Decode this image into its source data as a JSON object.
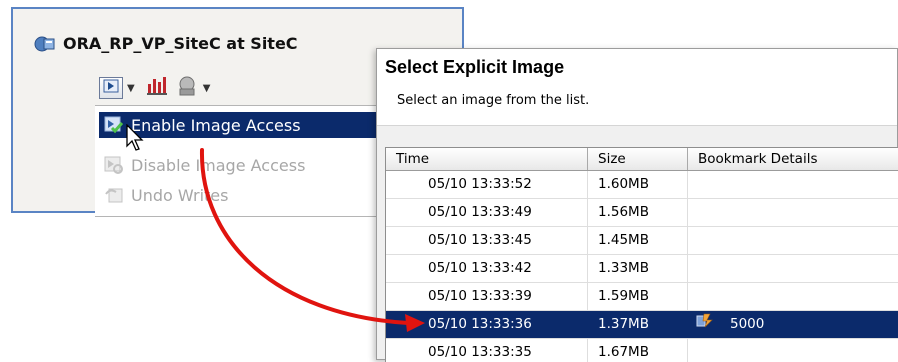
{
  "left_panel": {
    "title": "ORA_RP_VP_SiteC at SiteC",
    "toolbar": {
      "icons": [
        "image-access-icon",
        "dropdown-arrow",
        "bar-chart-icon",
        "support-icon",
        "dropdown-arrow"
      ]
    },
    "menu": {
      "items": [
        {
          "label": "Enable Image Access",
          "state": "selected",
          "icon": "enable-image-access-icon"
        },
        {
          "label": "Disable Image Access",
          "state": "disabled",
          "icon": "disable-image-access-icon"
        },
        {
          "label": "Undo Writes",
          "state": "disabled",
          "icon": "undo-writes-icon"
        }
      ]
    }
  },
  "dialog": {
    "title": "Select Explicit Image",
    "subtitle": "Select an image from the list.",
    "columns": [
      "Time",
      "Size",
      "Bookmark Details"
    ],
    "rows": [
      {
        "time": "05/10 13:33:52",
        "size": "1.60MB",
        "bookmark": ""
      },
      {
        "time": "05/10 13:33:49",
        "size": "1.56MB",
        "bookmark": ""
      },
      {
        "time": "05/10 13:33:45",
        "size": "1.45MB",
        "bookmark": ""
      },
      {
        "time": "05/10 13:33:42",
        "size": "1.33MB",
        "bookmark": ""
      },
      {
        "time": "05/10 13:33:39",
        "size": "1.59MB",
        "bookmark": ""
      },
      {
        "time": "05/10 13:33:36",
        "size": "1.37MB",
        "bookmark": "5000",
        "selected": true
      },
      {
        "time": "05/10 13:33:35",
        "size": "1.67MB",
        "bookmark": ""
      }
    ]
  },
  "colors": {
    "selection": "#0b2a6b",
    "panel_border": "#5a84c4",
    "annotation_arrow": "#e0140f"
  }
}
